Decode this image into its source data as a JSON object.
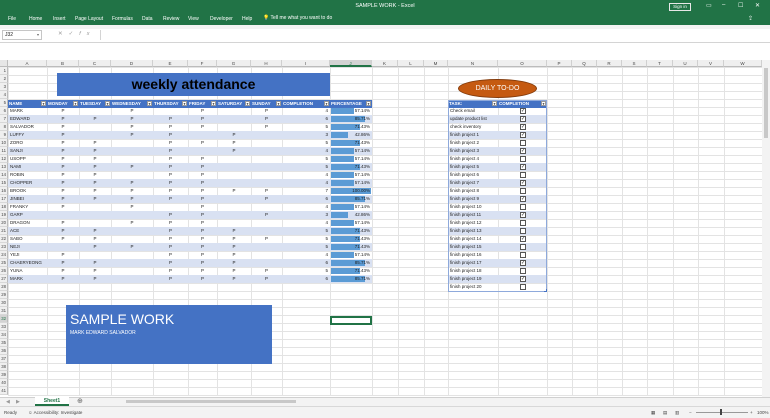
{
  "app": {
    "title": "SAMPLE WORK  -  Excel",
    "signin": "Sign in"
  },
  "ribbon": {
    "tabs": [
      "File",
      "Home",
      "Insert",
      "Page Layout",
      "Formulas",
      "Data",
      "Review",
      "View",
      "Developer",
      "Help"
    ],
    "tell": "Tell me what you want to do"
  },
  "formula": {
    "namebox": "J32",
    "value": ""
  },
  "columns": [
    "A",
    "B",
    "C",
    "D",
    "E",
    "F",
    "G",
    "H",
    "I",
    "J",
    "K",
    "L",
    "M",
    "N",
    "O",
    "P",
    "Q",
    "R",
    "S",
    "T",
    "U",
    "V",
    "W"
  ],
  "selected_col": "J",
  "selected_row": 32,
  "attendance": {
    "title": "weekly attendance",
    "headers": [
      "NAME",
      "MONDAY",
      "TUESDAY",
      "WEDNESDAY",
      "THURSDAY",
      "FRIDAY",
      "SATURDAY",
      "SUNDAY",
      "COMPLETION",
      "PERCENTAGE"
    ],
    "rows": [
      [
        "MARK",
        "P",
        "",
        "P",
        "",
        "P",
        "",
        "P",
        "4",
        "57.14%"
      ],
      [
        "EDWARD",
        "P",
        "P",
        "P",
        "P",
        "P",
        "",
        "P",
        "6",
        "85.71%"
      ],
      [
        "SALVADOR",
        "P",
        "",
        "P",
        "P",
        "P",
        "",
        "P",
        "5",
        "71.43%"
      ],
      [
        "LUFFY",
        "P",
        "",
        "P",
        "P",
        "",
        "P",
        "",
        "3",
        "42.86%"
      ],
      [
        "ZORO",
        "P",
        "P",
        "",
        "P",
        "P",
        "P",
        "",
        "5",
        "71.43%"
      ],
      [
        "SANJI",
        "P",
        "P",
        "",
        "P",
        "",
        "P",
        "",
        "4",
        "57.14%"
      ],
      [
        "USOPP",
        "P",
        "P",
        "",
        "P",
        "P",
        "",
        "",
        "5",
        "57.14%"
      ],
      [
        "NAMI",
        "P",
        "P",
        "P",
        "P",
        "P",
        "",
        "",
        "5",
        "71.43%"
      ],
      [
        "ROBIN",
        "P",
        "P",
        "",
        "P",
        "P",
        "",
        "",
        "4",
        "57.14%"
      ],
      [
        "CHOPPER",
        "P",
        "P",
        "P",
        "P",
        "P",
        "",
        "",
        "4",
        "57.14%"
      ],
      [
        "BROOK",
        "P",
        "P",
        "P",
        "P",
        "P",
        "P",
        "P",
        "7",
        "100.00%"
      ],
      [
        "JINBEI",
        "P",
        "P",
        "P",
        "P",
        "P",
        "",
        "P",
        "6",
        "85.71%"
      ],
      [
        "FRANKY",
        "P",
        "",
        "P",
        "",
        "P",
        "",
        "",
        "4",
        "57.14%"
      ],
      [
        "GARP",
        "",
        "",
        "",
        "P",
        "P",
        "",
        "P",
        "3",
        "42.86%"
      ],
      [
        "DRAGON",
        "P",
        "",
        "P",
        "P",
        "P",
        "",
        "",
        "4",
        "57.14%"
      ],
      [
        "ACE",
        "P",
        "P",
        "",
        "P",
        "P",
        "P",
        "",
        "5",
        "71.43%"
      ],
      [
        "SABO",
        "P",
        "P",
        "",
        "P",
        "P",
        "P",
        "P",
        "5",
        "71.43%"
      ],
      [
        "NEJI",
        "",
        "P",
        "P",
        "P",
        "P",
        "P",
        "",
        "5",
        "71.43%"
      ],
      [
        "YEJI",
        "P",
        "",
        "",
        "P",
        "P",
        "P",
        "",
        "4",
        "57.14%"
      ],
      [
        "CHAERYEONG",
        "P",
        "P",
        "",
        "P",
        "P",
        "P",
        "",
        "6",
        "85.71%"
      ],
      [
        "YUNA",
        "P",
        "P",
        "",
        "P",
        "P",
        "P",
        "P",
        "5",
        "71.43%"
      ],
      [
        "MARK",
        "P",
        "P",
        "",
        "P",
        "P",
        "P",
        "P",
        "6",
        "85.71%"
      ]
    ],
    "fractions": [
      0.5714,
      0.8571,
      0.7143,
      0.4286,
      0.7143,
      0.5714,
      0.5714,
      0.7143,
      0.5714,
      0.5714,
      1.0,
      0.8571,
      0.5714,
      0.4286,
      0.5714,
      0.7143,
      0.7143,
      0.7143,
      0.5714,
      0.8571,
      0.7143,
      0.8571
    ]
  },
  "todo": {
    "title": "DAILY TO-DO",
    "headers": [
      "TASK",
      "COMPLETION"
    ],
    "tasks": [
      {
        "task": "Check email",
        "done": true
      },
      {
        "task": "update product list",
        "done": true
      },
      {
        "task": "check inventory",
        "done": true
      },
      {
        "task": "finish project 1",
        "done": true
      },
      {
        "task": "finish project 2",
        "done": false
      },
      {
        "task": "finish project 3",
        "done": true
      },
      {
        "task": "finish project 4",
        "done": false
      },
      {
        "task": "finish project 5",
        "done": true
      },
      {
        "task": "finish project 6",
        "done": false
      },
      {
        "task": "finish project 7",
        "done": true
      },
      {
        "task": "finish project 8",
        "done": false
      },
      {
        "task": "finish project 9",
        "done": true
      },
      {
        "task": "finish project 10",
        "done": false
      },
      {
        "task": "finish project 11",
        "done": true
      },
      {
        "task": "finish project 12",
        "done": false
      },
      {
        "task": "finish project 13",
        "done": false
      },
      {
        "task": "finish project 14",
        "done": true
      },
      {
        "task": "finish project 15",
        "done": false
      },
      {
        "task": "finish project 16",
        "done": false
      },
      {
        "task": "finish project 17",
        "done": true
      },
      {
        "task": "finish project 18",
        "done": false
      },
      {
        "task": "finish project 19",
        "done": true
      },
      {
        "task": "finish project 20",
        "done": false
      }
    ]
  },
  "sample": {
    "title": "SAMPLE WORK",
    "subtitle": "MARK EDWARD SALVADOR"
  },
  "sheet": {
    "tab": "Sheet1"
  },
  "status": {
    "ready": "Ready",
    "accessibility": "Accessibility: Investigate",
    "zoom": "100%"
  },
  "colors": {
    "excel_green": "#217346",
    "table_blue": "#4472c4",
    "band": "#d9e1f2",
    "bar": "#5b9bd5",
    "oval": "#c55a11"
  }
}
